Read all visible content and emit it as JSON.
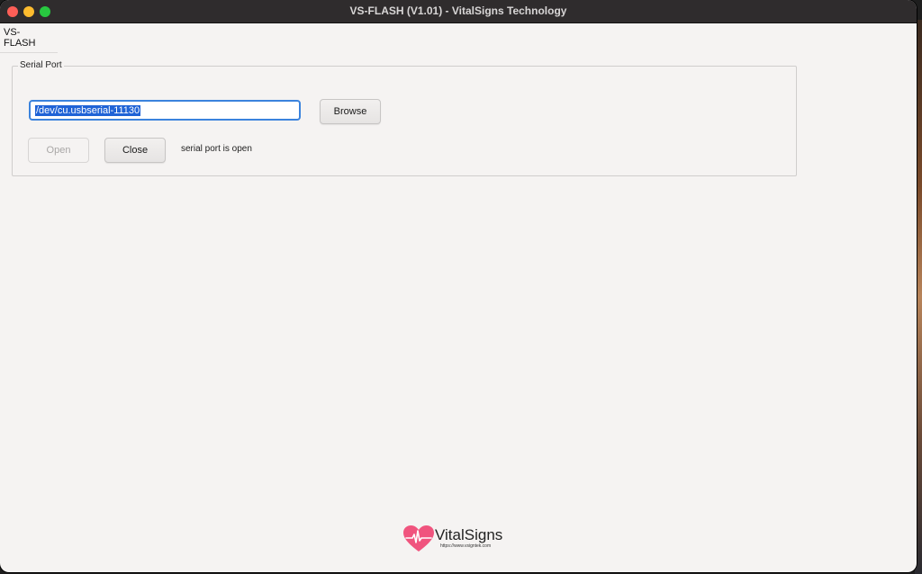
{
  "window": {
    "title": "VS-FLASH (V1.01) - VitalSigns Technology"
  },
  "tabs": [
    {
      "label": "VS-FLASH"
    }
  ],
  "serial_port": {
    "group_label": "Serial Port",
    "port_value": "/dev/cu.usbserial-11130",
    "browse_label": "Browse",
    "open_label": "Open",
    "close_label": "Close",
    "status_text": "serial port is open"
  },
  "logo": {
    "name": "VitalSigns",
    "url": "https://www.vsigntek.com",
    "icon": "heart-pulse-icon"
  },
  "colors": {
    "accent": "#3b83dd",
    "selection": "#1f63d6",
    "brand": "#f0547e"
  }
}
